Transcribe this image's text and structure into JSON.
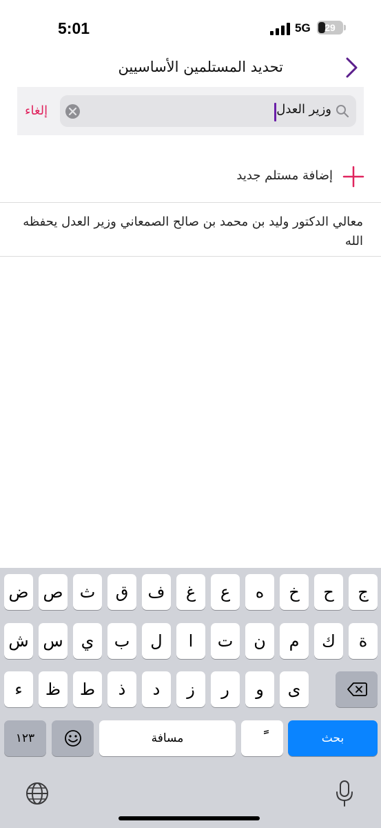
{
  "status_bar": {
    "time": "5:01",
    "network": "5G",
    "battery": "29",
    "battery_fraction": 0.29
  },
  "header": {
    "title": "تحديد المستلمين الأساسيين"
  },
  "search": {
    "value": "وزير العدل",
    "cancel_label": "إلغاء"
  },
  "add_recipient": {
    "label": "إضافة مستلم جديد"
  },
  "results": [
    {
      "text": "معالي الدكتور وليد بن محمد بن صالح الصمعاني وزير العدل يحفظه الله"
    }
  ],
  "keyboard": {
    "row1": [
      "ج",
      "ح",
      "خ",
      "ه",
      "ع",
      "غ",
      "ف",
      "ق",
      "ث",
      "ص",
      "ض"
    ],
    "row2": [
      "ة",
      "ك",
      "م",
      "ن",
      "ت",
      "ا",
      "ل",
      "ب",
      "ي",
      "س",
      "ش"
    ],
    "row3": [
      "ى",
      "و",
      "ر",
      "ز",
      "د",
      "ذ",
      "ط",
      "ظ",
      "ء"
    ],
    "search_key": "بحث",
    "tanween_key": "ًً",
    "space_key": "مسافة",
    "numbers_key": "١٢٣"
  }
}
